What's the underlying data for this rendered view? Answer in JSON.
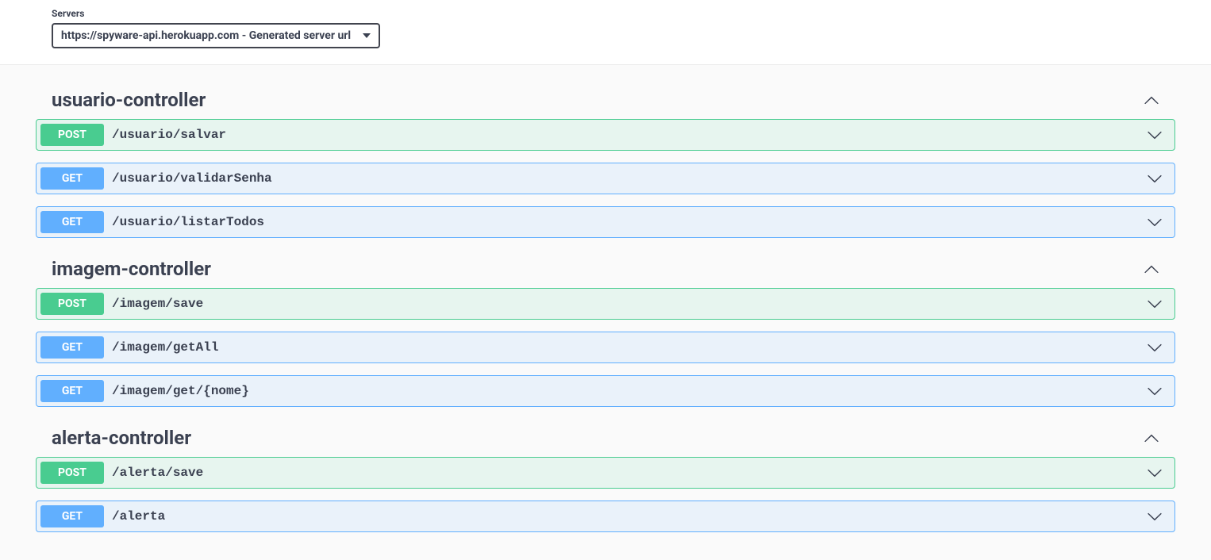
{
  "servers": {
    "label": "Servers",
    "selected": "https://spyware-api.herokuapp.com - Generated server url"
  },
  "tags": [
    {
      "name": "usuario-controller",
      "operations": [
        {
          "method": "POST",
          "path": "/usuario/salvar"
        },
        {
          "method": "GET",
          "path": "/usuario/validarSenha"
        },
        {
          "method": "GET",
          "path": "/usuario/listarTodos"
        }
      ]
    },
    {
      "name": "imagem-controller",
      "operations": [
        {
          "method": "POST",
          "path": "/imagem/save"
        },
        {
          "method": "GET",
          "path": "/imagem/getAll"
        },
        {
          "method": "GET",
          "path": "/imagem/get/{nome}"
        }
      ]
    },
    {
      "name": "alerta-controller",
      "operations": [
        {
          "method": "POST",
          "path": "/alerta/save"
        },
        {
          "method": "GET",
          "path": "/alerta"
        }
      ]
    }
  ]
}
